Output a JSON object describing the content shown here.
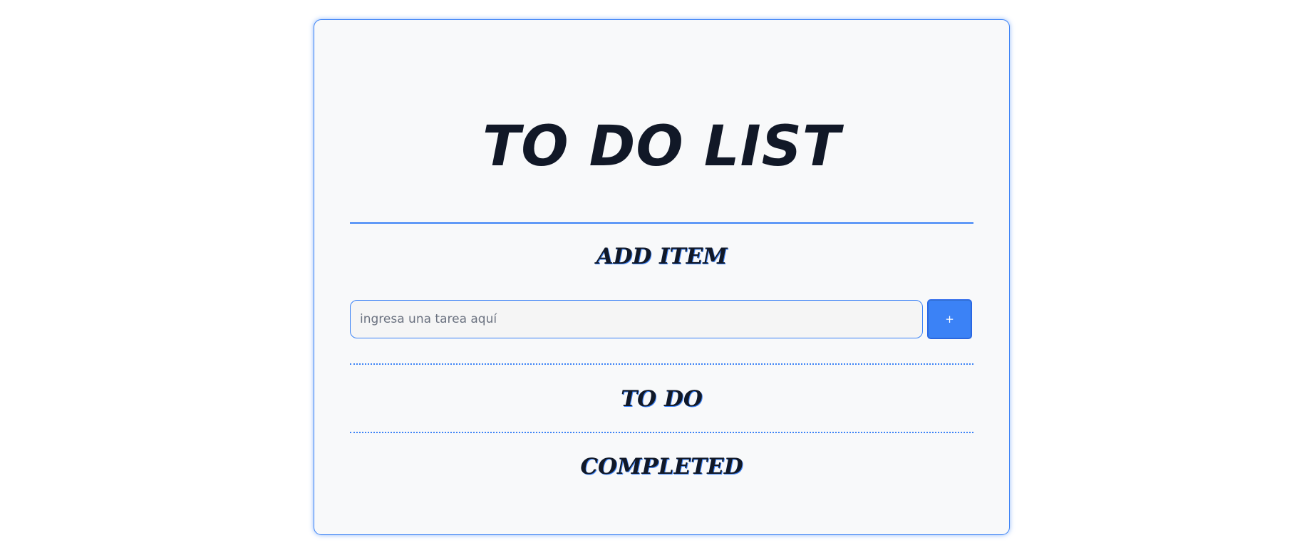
{
  "app": {
    "title": "TO DO LIST"
  },
  "add_section": {
    "heading": "ADD ITEM",
    "input": {
      "value": "",
      "placeholder": "ingresa una tarea aquí"
    },
    "add_button_label": "+"
  },
  "todo_section": {
    "heading": "TO DO",
    "items": []
  },
  "completed_section": {
    "heading": "COMPLETED",
    "items": []
  },
  "colors": {
    "accent": "#3b82f6",
    "text": "#111827",
    "card_background": "#f8f9fa"
  }
}
